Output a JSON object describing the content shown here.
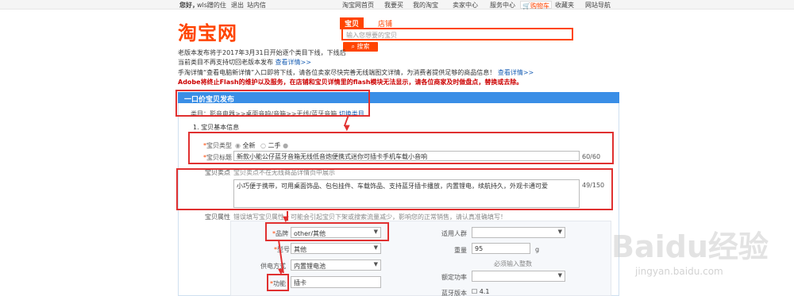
{
  "topbar": {
    "greeting": "您好，",
    "user": "wls蹭的住",
    "logout": "退出",
    "messages": "站内信",
    "nav": [
      "淘宝网首页",
      "我要买",
      "我的淘宝",
      "卖家中心",
      "服务中心",
      "购物车",
      "收藏夹",
      "网站导航"
    ]
  },
  "logo": "淘宝网",
  "search": {
    "tab_active": "宝贝",
    "tab_other": "店铺",
    "placeholder": "输入您想要的宝贝",
    "button": "搜索"
  },
  "notices": {
    "line1": "老版本发布将于2017年3月31日开始逐个类目下线，下线后",
    "line2_pre": "当前类目不再支持切回老版本发布 ",
    "line2_link": "查看详情>>",
    "line3_pre": "手淘详情“查看电脑新详情”入口即将下线，请各位卖家尽快完善无线端图文详情，为消费者提供足够的商品信息！ ",
    "line3_link": "查看详情>>",
    "line4": "Adobe将终止Flash的维护以及服务，在店铺和宝贝详情里的flash模块无法显示，请各位商家及时做盘点，替换或去除。"
  },
  "panel": {
    "title": "一口价宝贝发布",
    "category_label": "类目：",
    "category_path": "影音电器>>桌面音响/音箱>>无线/蓝牙音箱",
    "category_switch": "切换类目",
    "section1": "1. 宝贝基本信息",
    "type_label": "宝贝类型",
    "type_new": "全新",
    "type_used": "二手",
    "title_label": "宝贝标题",
    "title_value": "新款小能公仔蓝牙音箱无线低音炮便携式迷你可插卡手机车载小音响",
    "title_count": "60/60",
    "selling_label": "宝贝卖点",
    "selling_hint": "宝贝卖点不在无线商品详情页中展示",
    "selling_value": "小巧便于携带，可用桌面饰品、包包挂件、车载饰品、支持蓝牙插卡播放，内置锂电，续航持久，外观卡通可爱",
    "selling_count": "49/150",
    "attr_label": "宝贝属性",
    "attr_hint": "错误填写宝贝属性，可能会引起宝贝下架或搜索流量减少，影响您的正常销售，请认真准确填写！"
  },
  "attrs": {
    "brand_label": "品牌",
    "brand_value": "other/其他",
    "model_label": "型号",
    "model_value": "其他",
    "power_label": "供电方式",
    "power_value": "内置锂电池",
    "func_label": "功能",
    "func_value": "插卡",
    "crowd_label": "适用人群",
    "crowd_value": "",
    "weight_label": "重量",
    "weight_value": "95",
    "weight_unit": "g",
    "weight_hint": "必须输入整数",
    "rated_label": "额定功率",
    "rated_value": "",
    "bt_label": "蓝牙版本",
    "bt_value": "4.1"
  },
  "watermark": {
    "brand": "Baidu经验",
    "url": "jingyan.baidu.com"
  },
  "colors": {
    "accent": "#ff4400",
    "panel_header": "#3a8ee6",
    "annotation": "#e03030"
  }
}
